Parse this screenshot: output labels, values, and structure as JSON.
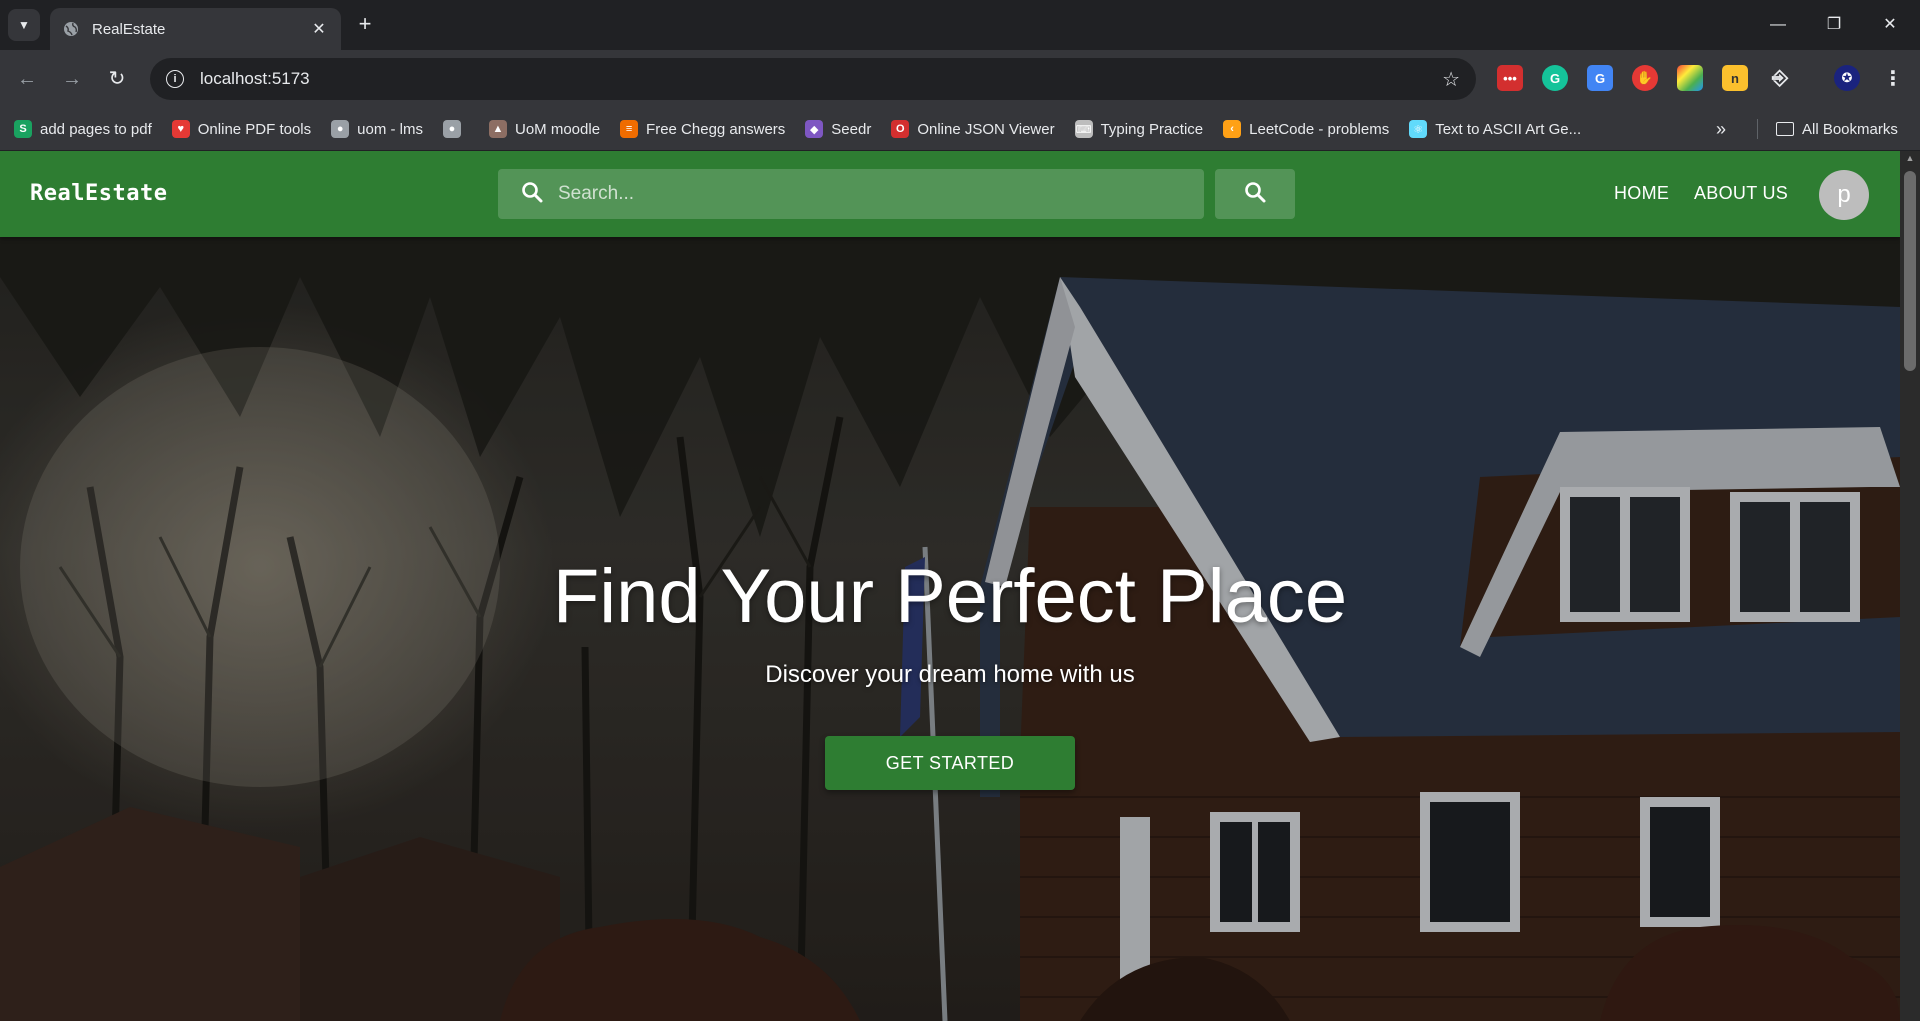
{
  "browser": {
    "tab_title": "RealEstate",
    "url": "localhost:5173",
    "bookmarks": [
      {
        "label": "add pages to pdf",
        "icon": "s-icon",
        "color": "#1aa260"
      },
      {
        "label": "Online PDF tools",
        "icon": "heart-icon",
        "color": "#e53935"
      },
      {
        "label": "uom - lms",
        "icon": "globe-icon",
        "color": "#9aa0a6"
      },
      {
        "label": "",
        "icon": "globe-icon",
        "color": "#9aa0a6"
      },
      {
        "label": "UoM moodle",
        "icon": "moodle-icon",
        "color": "#8d6e63"
      },
      {
        "label": "Free Chegg answers",
        "icon": "books-icon",
        "color": "#ef6c00"
      },
      {
        "label": "Seedr",
        "icon": "seed-icon",
        "color": "#7e57c2"
      },
      {
        "label": "Online JSON Viewer",
        "icon": "opera-icon",
        "color": "#d32f2f"
      },
      {
        "label": "Typing Practice",
        "icon": "keyboard-icon",
        "color": "#bdbdbd"
      },
      {
        "label": "LeetCode - problems",
        "icon": "leetcode-icon",
        "color": "#ffa116"
      },
      {
        "label": "Text to ASCII Art Ge...",
        "icon": "react-icon",
        "color": "#61dafb"
      }
    ],
    "all_bookmarks": "All Bookmarks"
  },
  "nav": {
    "brand": "RealEstate",
    "search_placeholder": "Search...",
    "home": "HOME",
    "about": "ABOUT US",
    "avatar_letter": "p"
  },
  "hero": {
    "title": "Find Your Perfect Place",
    "subtitle": "Discover your dream home with us",
    "cta": "GET STARTED"
  },
  "colors": {
    "primary": "#2e7d32",
    "chrome_dark": "#202124",
    "chrome_toolbar": "#35363a"
  }
}
